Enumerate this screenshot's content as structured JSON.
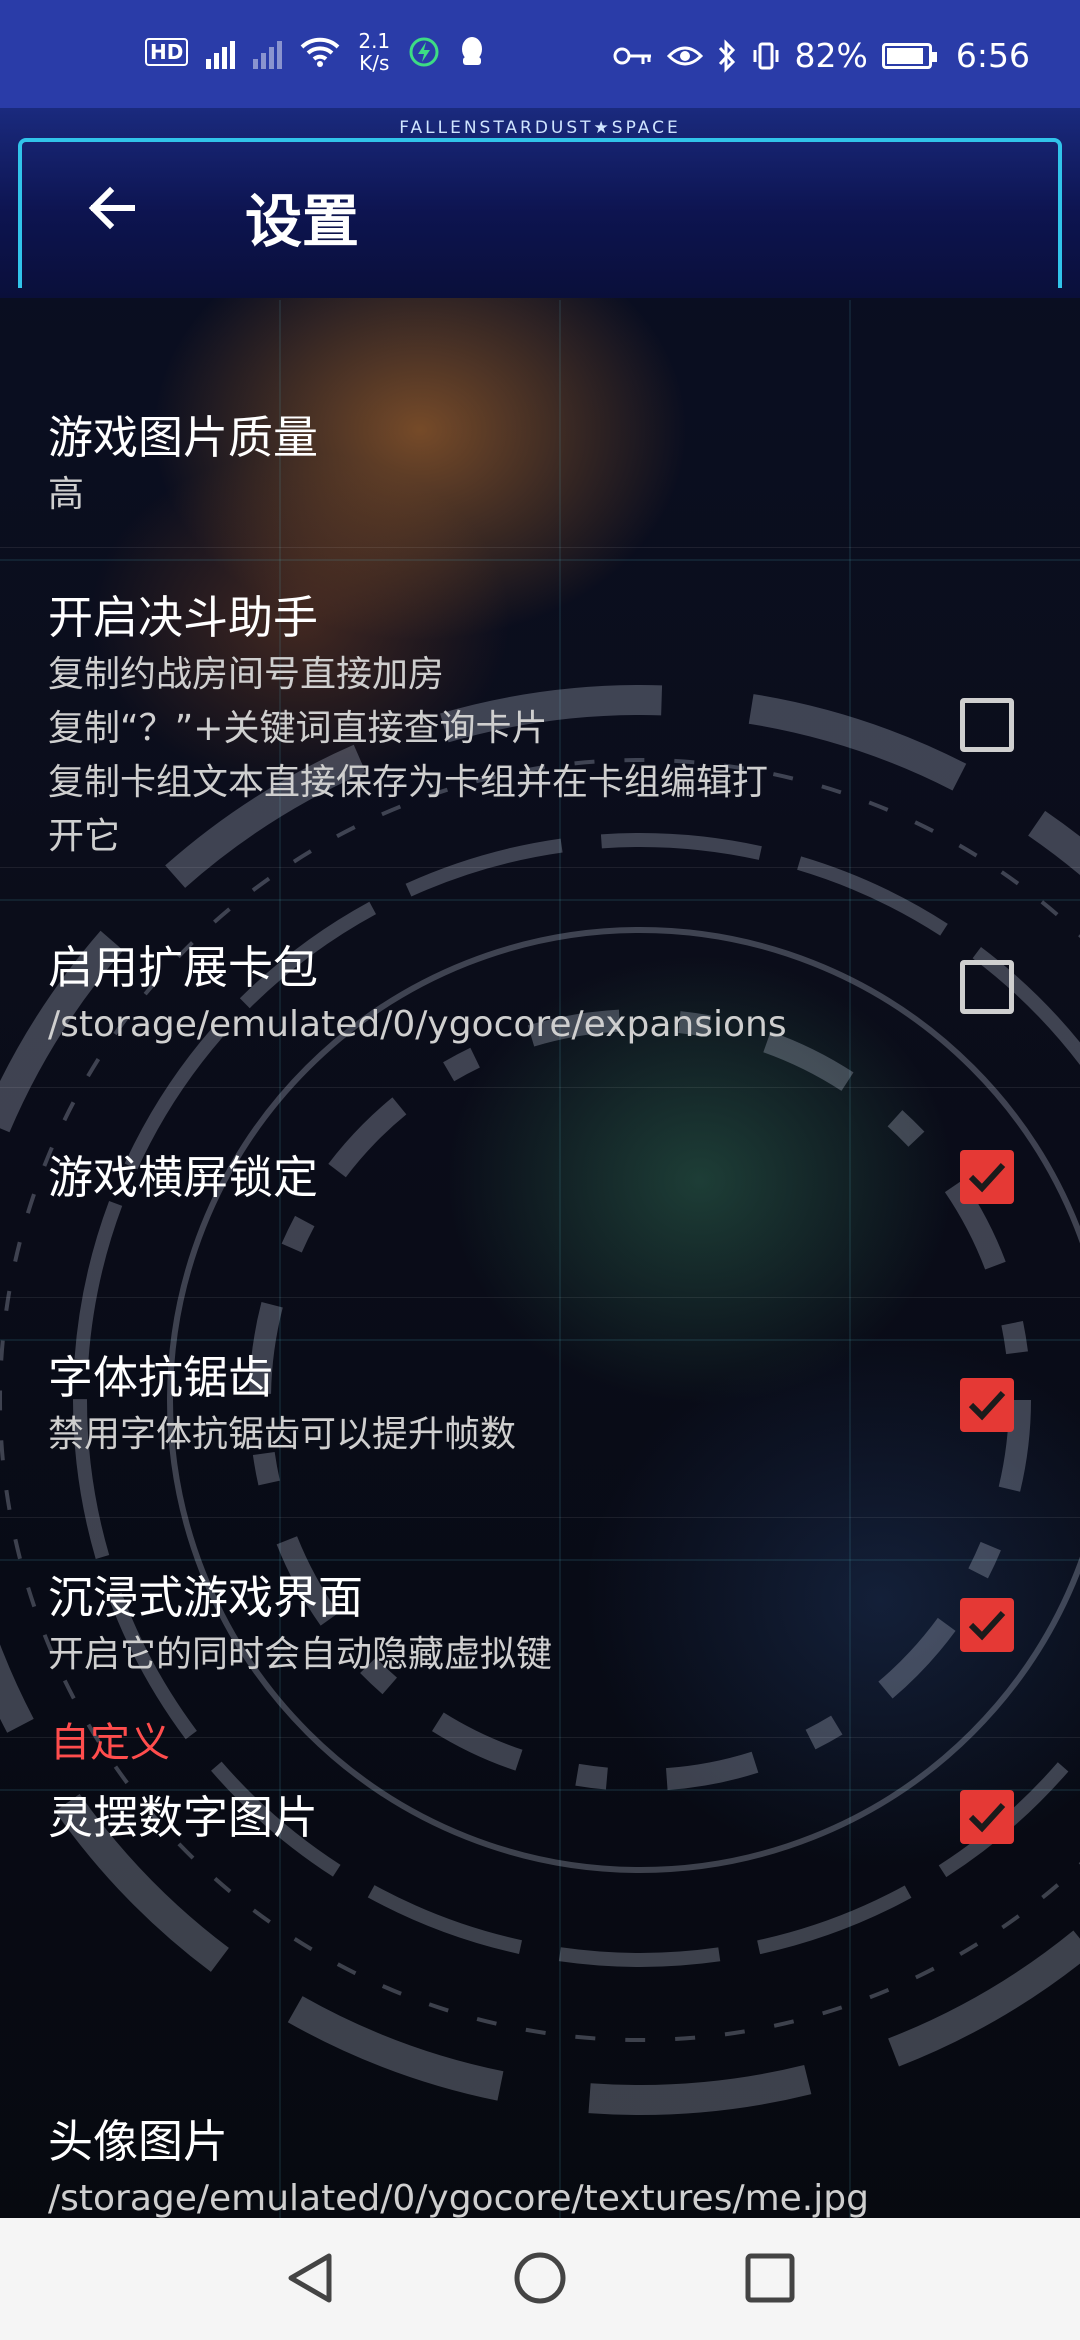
{
  "status_bar": {
    "speed_value": "2.1",
    "speed_unit": "K/s",
    "battery": "82%",
    "time": "6:56",
    "icons": [
      "hd-icon",
      "signal-4g-icon",
      "signal-icon",
      "wifi-icon",
      "charge-icon",
      "qq-icon",
      "key-icon",
      "eye-icon",
      "bluetooth-icon",
      "vibrate-icon",
      "battery-icon"
    ]
  },
  "header": {
    "brand": "FALLENSTARDUST★SPACE",
    "title": "设置",
    "back_icon": "arrow-left-icon",
    "accent": "#31c4ea"
  },
  "settings": [
    {
      "title": "游戏图片质量",
      "subtitle": [
        "高"
      ],
      "checkbox": null
    },
    {
      "title": "开启决斗助手",
      "subtitle": [
        "复制约战房间号直接加房",
        "复制“？”+关键词直接查询卡片",
        "复制卡组文本直接保存为卡组并在卡组编辑打",
        "开它"
      ],
      "checkbox": false
    },
    {
      "title": "启用扩展卡包",
      "subtitle": [
        "/storage/emulated/0/ygocore/expansions"
      ],
      "checkbox": false
    },
    {
      "title": "游戏横屏锁定",
      "subtitle": [],
      "checkbox": true
    },
    {
      "title": "字体抗锯齿",
      "subtitle": [
        "禁用字体抗锯齿可以提升帧数"
      ],
      "checkbox": true
    },
    {
      "title": "沉浸式游戏界面",
      "subtitle": [
        "开启它的同时会自动隐藏虚拟键"
      ],
      "checkbox": true
    },
    {
      "title": "灵摆数字图片",
      "subtitle": [],
      "checkbox": true
    }
  ],
  "section_custom": {
    "label": "自定义",
    "color": "#ff4d4d",
    "items": [
      {
        "title": "头像图片",
        "subtitle": [
          "/storage/emulated/0/ygocore/textures/me.jpg"
        ]
      }
    ]
  },
  "checkbox_color": "#e53935",
  "nav_bar": {
    "back": "nav-back-icon",
    "home": "nav-home-icon",
    "recents": "nav-recents-icon"
  }
}
